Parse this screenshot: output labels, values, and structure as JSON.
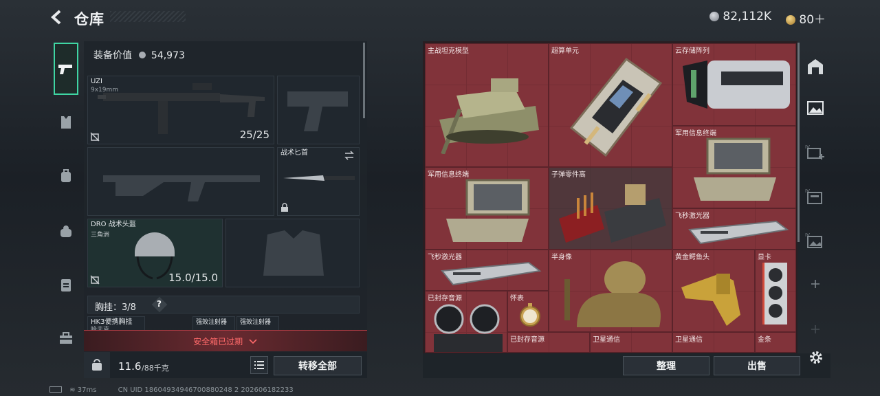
{
  "header": {
    "title": "仓库",
    "currency_value": "82,112K",
    "coupon_value": "80＋"
  },
  "loadout": {
    "equipment_value_label": "装备价值",
    "equipment_value": "54,973",
    "primary": {
      "name": "UZI",
      "caliber": "9x19mm",
      "ammo": "25/25"
    },
    "melee": {
      "name": "战术匕首"
    },
    "helmet": {
      "name": "DRO 战术头盔",
      "tag": "三角洲",
      "durability": "15.0/15.0"
    },
    "rig": {
      "label": "胸挂：3/8",
      "help": "?"
    },
    "rig_items": [
      "HK3便携胸挂",
      "强效注射器",
      "强效注射器"
    ],
    "rig_item_extra": "哈夫克",
    "safebox_expired": "安全箱已过期",
    "weight": "11.6",
    "weight_max": "/88千克",
    "transfer_all": "转移全部"
  },
  "storage": {
    "items": [
      {
        "id": "tank",
        "label": "主战坦克模型"
      },
      {
        "id": "supercomputer",
        "label": "超算单元"
      },
      {
        "id": "cloud-array",
        "label": "云存储阵列"
      },
      {
        "id": "mil-terminal-a",
        "label": "军用信息终端"
      },
      {
        "id": "mil-terminal-b",
        "label": "军用信息终端"
      },
      {
        "id": "bullet-parts",
        "label": "子弹零件高"
      },
      {
        "id": "femto-laser-a",
        "label": "飞秒激光器"
      },
      {
        "id": "femto-laser-b",
        "label": "飞秒激光器"
      },
      {
        "id": "bust",
        "label": "半身像"
      },
      {
        "id": "golden-croc",
        "label": "黄金鳄鱼头"
      },
      {
        "id": "gpu",
        "label": "显卡"
      },
      {
        "id": "sealed-audio-a",
        "label": "已封存音源"
      },
      {
        "id": "pocket-watch",
        "label": "怀表"
      },
      {
        "id": "sealed-audio-b",
        "label": "已封存音源"
      },
      {
        "id": "sat-comm-a",
        "label": "卫星通信"
      },
      {
        "id": "sat-comm-b",
        "label": "卫星通信"
      },
      {
        "id": "gold-bar",
        "label": "金条"
      }
    ],
    "sort_button": "整理",
    "sell_button": "出售"
  },
  "footer": {
    "ping": "37ms",
    "uid": "CN UID 18604934946700880248 2 202606182233"
  },
  "colors": {
    "accent": "#3fd6a3",
    "storage_bg": "#7a3138",
    "danger": "#e04a4a"
  }
}
